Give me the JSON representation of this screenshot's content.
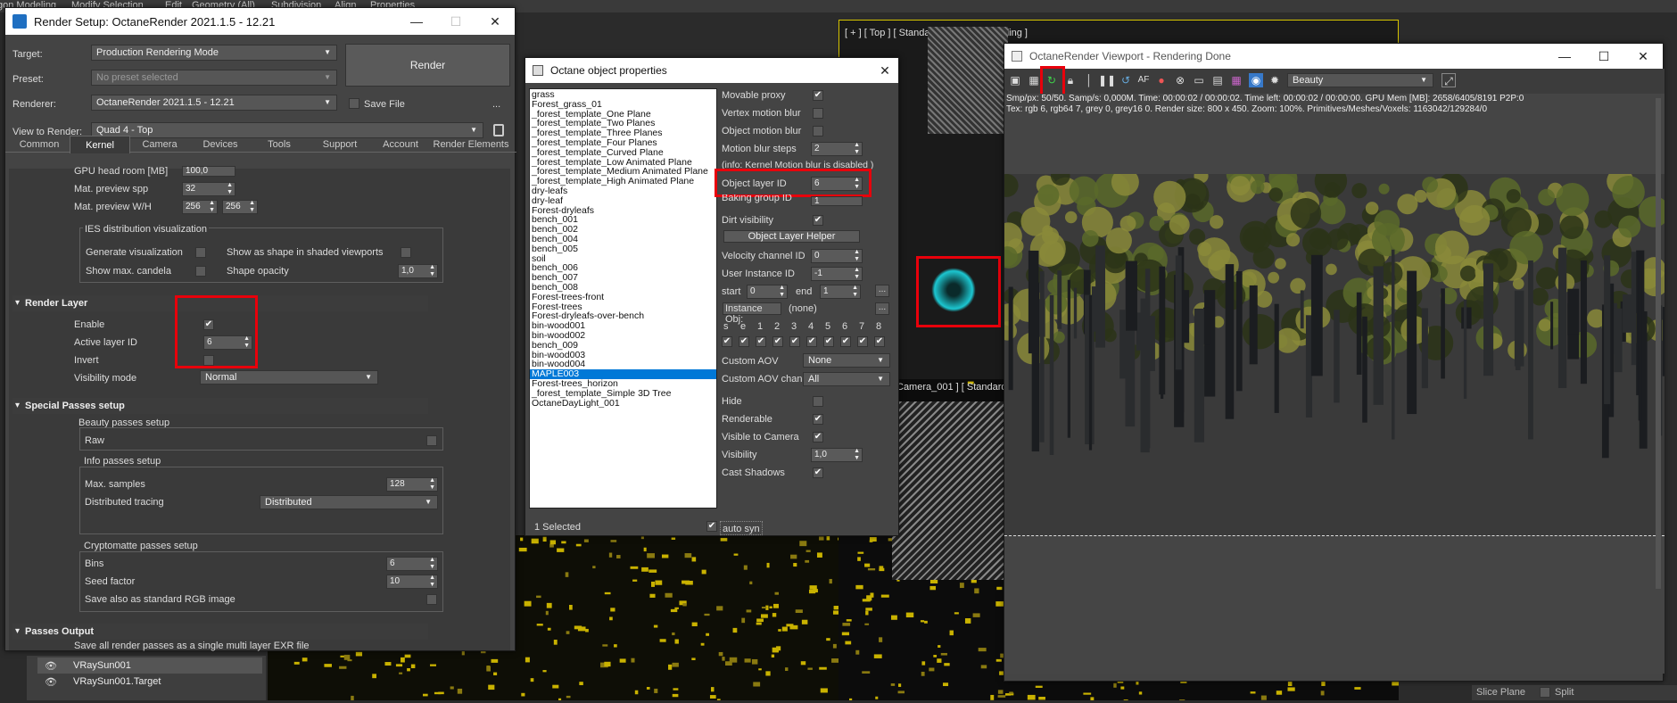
{
  "menubar": [
    "gon Modeling",
    "Modify Selection",
    "Edit",
    "Geometry (All)",
    "Subdivision",
    "Align",
    "Properties"
  ],
  "render_setup": {
    "title": "Render Setup: OctaneRender 2021.1.5 - 12.21",
    "target_label": "Target:",
    "target_value": "Production Rendering Mode",
    "preset_label": "Preset:",
    "preset_value": "No preset selected",
    "renderer_label": "Renderer:",
    "renderer_value": "OctaneRender 2021.1.5 - 12.21",
    "save_file": "Save File",
    "view_label": "View to Render:",
    "view_value": "Quad 4 - Top",
    "render_button": "Render",
    "more": "...",
    "tabs": [
      "Common",
      "Kernel",
      "Camera",
      "Devices",
      "Tools",
      "Support",
      "Account",
      "Render Elements"
    ],
    "gpu_head": "GPU head room [MB]",
    "gpu_head_value": "100,0",
    "mat_spp": "Mat. preview spp",
    "mat_spp_value": "32",
    "mat_wh": "Mat. preview W/H",
    "mat_w": "256",
    "mat_h": "256",
    "ies_title": "IES distribution visualization",
    "ies_generate": "Generate visualization",
    "ies_show_shape": "Show as shape in shaded viewports",
    "ies_show_max": "Show max. candela",
    "ies_shape_opacity": "Shape opacity",
    "ies_shape_opacity_value": "1,0",
    "render_layer": {
      "header": "Render Layer",
      "enable": "Enable",
      "active_layer": "Active layer ID",
      "active_layer_value": "6",
      "invert": "Invert",
      "visibility_mode": "Visibility mode",
      "visibility_value": "Normal"
    },
    "special_passes": {
      "header": "Special Passes setup",
      "beauty_title": "Beauty passes setup",
      "raw": "Raw",
      "info_title": "Info passes setup",
      "max_samples": "Max. samples",
      "max_samples_value": "128",
      "dist_tracing": "Distributed tracing",
      "dist_tracing_value": "Distributed",
      "crypto_title": "Cryptomatte passes setup",
      "bins": "Bins",
      "bins_value": "6",
      "seed": "Seed factor",
      "seed_value": "10",
      "save_rgb": "Save also as standard RGB image"
    },
    "passes_output": {
      "header": "Passes Output",
      "save_exr": "Save all render passes as a single multi layer EXR file"
    }
  },
  "scene_list": [
    "VRaySun001",
    "VRaySun001.Target"
  ],
  "viewport_labels": {
    "top": "[ + ] [ Top ] [ Standard ] [ Default Shading ]",
    "camera": "Camera_001 ] [ Standard"
  },
  "object_props": {
    "title": "Octane object properties",
    "objects": [
      "grass",
      "Forest_grass_01",
      "_forest_template_One Plane",
      "_forest_template_Two Planes",
      "_forest_template_Three Planes",
      "_forest_template_Four Planes",
      "_forest_template_Curved Plane",
      "_forest_template_Low Animated Plane",
      "_forest_template_Medium Animated Plane",
      "_forest_template_High Animated Plane",
      "dry-leafs",
      "dry-leaf",
      "Forest-dryleafs",
      "bench_001",
      "bench_002",
      "bench_004",
      "bench_005",
      "soil",
      "bench_006",
      "bench_007",
      "bench_008",
      "Forest-trees-front",
      "Forest-trees",
      "Forest-dryleafs-over-bench",
      "bin-wood001",
      "bin-wood002",
      "bench_009",
      "bin-wood003",
      "bin-wood004",
      "MAPLE003",
      "Forest-trees_horizon",
      "_forest_template_Simple 3D Tree",
      "OctaneDayLight_001"
    ],
    "selected": "MAPLE003",
    "selected_count": "1 Selected",
    "auto_sync": "auto syn",
    "movable_proxy": "Movable proxy",
    "vertex_mb": "Vertex motion blur",
    "object_mb": "Object motion blur",
    "mb_steps": "Motion blur steps",
    "mb_steps_value": "2",
    "info_mb": "(info: Kernel Motion blur is disabled )",
    "object_layer": "Object layer ID",
    "object_layer_value": "6",
    "baking": "Baking group ID",
    "baking_value": "1",
    "dirt": "Dirt visibility",
    "layer_helper": "Object Layer Helper",
    "velocity": "Velocity channel ID",
    "velocity_value": "0",
    "user_instance": "User Instance ID",
    "user_instance_value": "-1",
    "start": "start",
    "start_value": "0",
    "end": "end",
    "end_value": "1",
    "ellipsis": "...",
    "instance_obj": "Instance Obj:",
    "instance_none": "(none)",
    "channels": [
      "s",
      "e",
      "1",
      "2",
      "3",
      "4",
      "5",
      "6",
      "7",
      "8"
    ],
    "custom_aov": "Custom AOV",
    "custom_aov_value": "None",
    "custom_aov_chan": "Custom AOV chan.",
    "custom_aov_chan_value": "All",
    "hide": "Hide",
    "renderable": "Renderable",
    "visible_camera": "Visible to Camera",
    "visibility": "Visibility",
    "visibility_value": "1,0",
    "cast_shadows": "Cast Shadows"
  },
  "octane_viewport": {
    "title": "OctaneRender Viewport - Rendering Done",
    "pass_value": "Beauty",
    "stats_line1": "Smp/px: 50/50.   Samp/s: 0,000M.   Time: 00:00:02 / 00:00:02.   Time left: 00:00:02 / 00:00:00.   GPU Mem [MB]: 2658/6405/8191 P2P:0",
    "stats_line2": "Tex: rgb 6, rgb64 7, grey 0, grey16 0.   Render size: 800 x 450.   Zoom: 100%.   Primitives/Meshes/Voxels: 1163042/129284/0"
  },
  "statusbar": {
    "slice_plane": "Slice Plane",
    "split": "Split"
  }
}
